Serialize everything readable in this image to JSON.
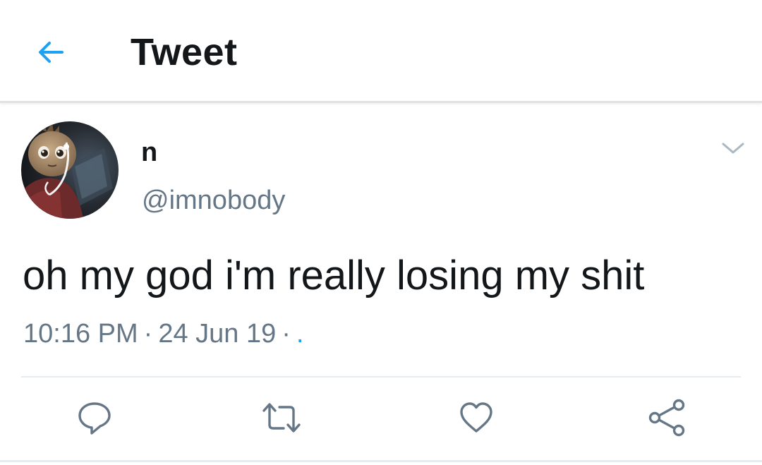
{
  "header": {
    "back_icon": "arrow-left-icon",
    "title": "Tweet"
  },
  "tweet": {
    "display_name": "n",
    "handle": "@imnobody",
    "text": "oh my god i'm really losing my shit",
    "time": "10:16 PM",
    "separator": "·",
    "date": "24 Jun 19",
    "source": ".",
    "menu_icon": "chevron-down-icon"
  },
  "actions": {
    "reply_icon": "reply-icon",
    "retweet_icon": "retweet-icon",
    "like_icon": "heart-icon",
    "share_icon": "share-icon"
  },
  "colors": {
    "accent": "#1da1f2",
    "text_primary": "#14171a",
    "text_secondary": "#657786",
    "divider": "#e6ecf0"
  }
}
